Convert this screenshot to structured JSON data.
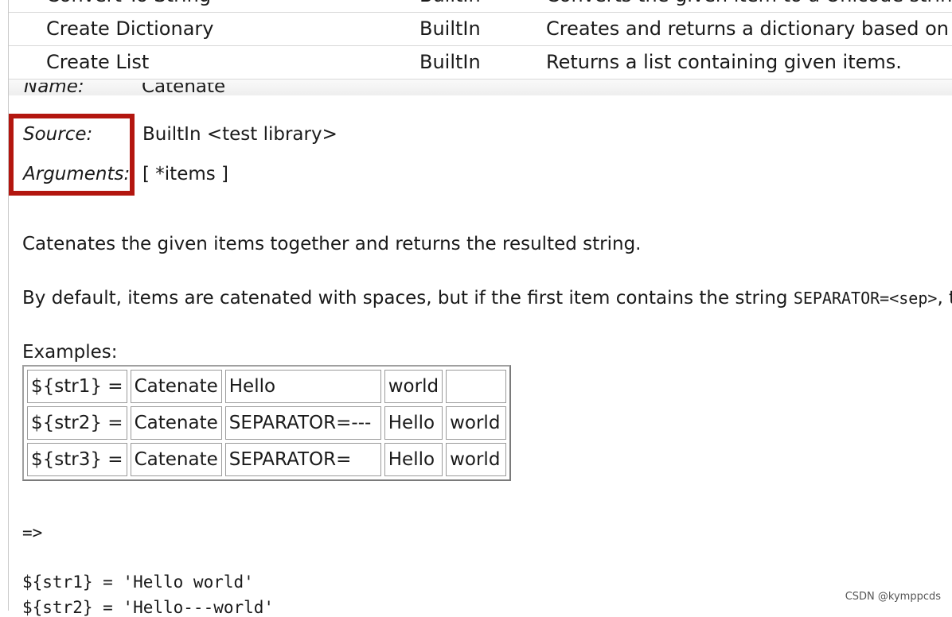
{
  "keyword_list": {
    "rows": [
      {
        "name": "Convert To String",
        "source": "BuiltIn",
        "description": "Converts the given item to a Unicode string."
      },
      {
        "name": "Create Dictionary",
        "source": "BuiltIn",
        "description": "Creates and returns a dictionary based on t"
      },
      {
        "name": "Create List",
        "source": "BuiltIn",
        "description": "Returns a list containing given items."
      }
    ]
  },
  "details": {
    "name_label": "Name:",
    "name_value": "Catenate",
    "source_label": "Source:",
    "source_value": "BuiltIn <test library>",
    "arguments_label": "Arguments:",
    "arguments_value": "[ *items ]"
  },
  "doc": {
    "para1": "Catenates the given items together and returns the resulted string.",
    "para2_prefix": "By default, items are catenated with spaces, but if the first item contains the string ",
    "para2_code": "SEPARATOR=<sep>",
    "para2_suffix": ", th",
    "examples_label": "Examples:",
    "examples": [
      [
        "${str1} =",
        "Catenate",
        "Hello",
        "world",
        ""
      ],
      [
        "${str2} =",
        "Catenate",
        "SEPARATOR=---",
        "Hello",
        "world"
      ],
      [
        "${str3} =",
        "Catenate",
        "SEPARATOR=",
        "Hello",
        "world"
      ]
    ],
    "arrow": "=>",
    "result_line1": "${str1} = 'Hello world'",
    "result_line2": "${str2} = 'Hello---world'"
  },
  "watermark": "CSDN @kymppcds",
  "colors": {
    "highlight": "#b3160f"
  }
}
